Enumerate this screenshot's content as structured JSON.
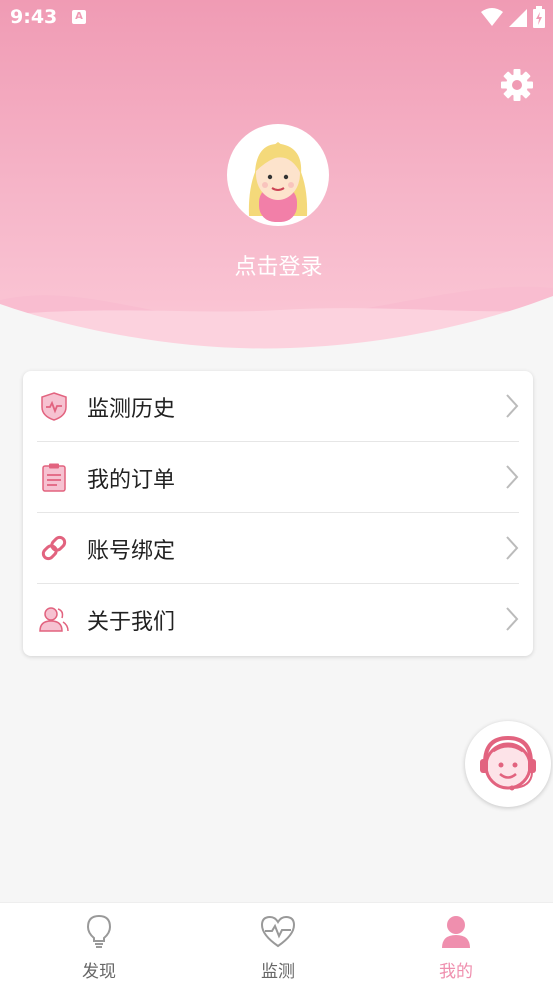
{
  "status": {
    "time": "9:43",
    "notification_icon": "A"
  },
  "header": {
    "login_text": "点击登录",
    "avatar_icon": "user-avatar",
    "settings_icon": "gear-icon"
  },
  "menu": {
    "items": [
      {
        "label": "监测历史",
        "icon": "shield-pulse-icon"
      },
      {
        "label": "我的订单",
        "icon": "clipboard-icon"
      },
      {
        "label": "账号绑定",
        "icon": "link-icon"
      },
      {
        "label": "关于我们",
        "icon": "people-icon"
      }
    ]
  },
  "tabs": [
    {
      "label": "发现",
      "icon": "lightbulb-icon",
      "active": false
    },
    {
      "label": "监测",
      "icon": "heart-pulse-icon",
      "active": false
    },
    {
      "label": "我的",
      "icon": "user-icon",
      "active": true
    }
  ],
  "colors": {
    "accent": "#ef8fae",
    "header_top": "#f09bb4",
    "icon": "#e2637f"
  }
}
